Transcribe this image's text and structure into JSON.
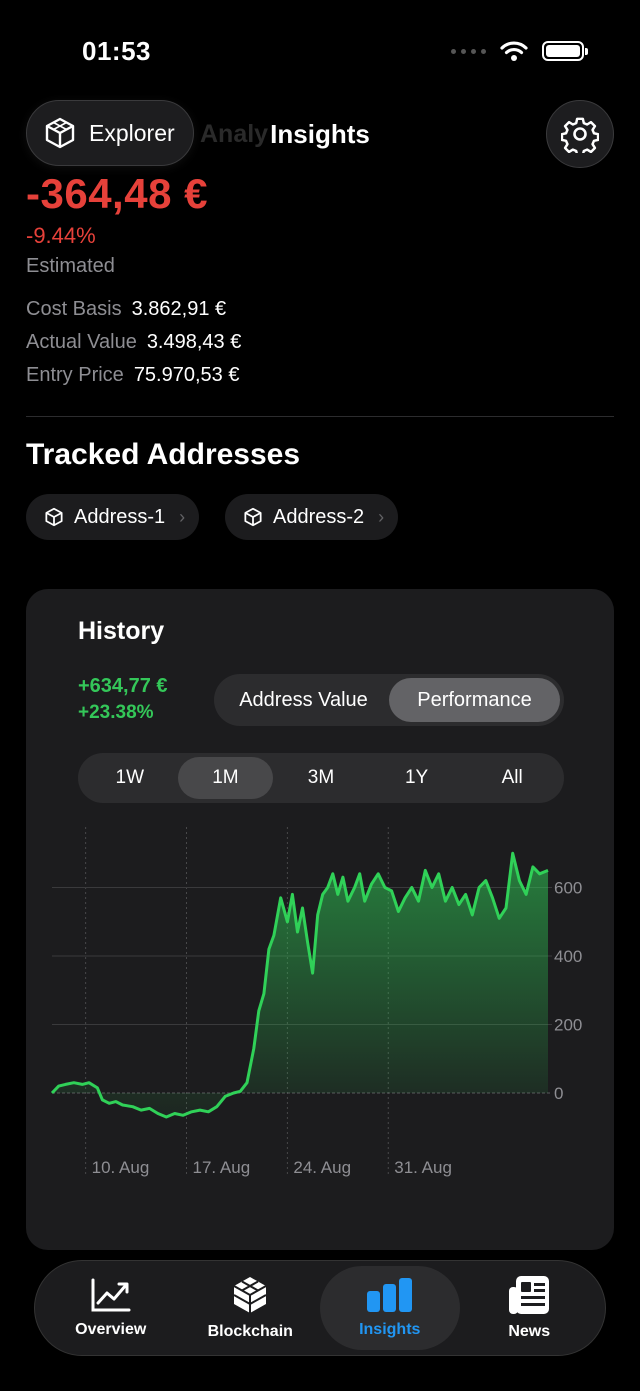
{
  "status": {
    "time": "01:53"
  },
  "nav": {
    "explorer_label": "Explorer",
    "title": "Insights",
    "ghost_title": "Analy"
  },
  "summary": {
    "pl_value": "-364,48 €",
    "pl_percent": "-9.44%",
    "estimated": "Estimated",
    "stats": [
      {
        "label": "Cost Basis",
        "value": "3.862,91 €"
      },
      {
        "label": "Actual Value",
        "value": "3.498,43 €"
      },
      {
        "label": "Entry Price",
        "value": "75.970,53 €"
      }
    ],
    "loss_color": "#e6413a"
  },
  "tracked": {
    "title": "Tracked Addresses",
    "addresses": [
      {
        "label": "Address-1"
      },
      {
        "label": "Address-2"
      }
    ]
  },
  "history": {
    "title": "History",
    "change_value": "+634,77 €",
    "change_percent": "+23.38%",
    "gain_color": "#34c759",
    "modes": [
      {
        "label": "Address Value",
        "active": false
      },
      {
        "label": "Performance",
        "active": true
      }
    ],
    "ranges": [
      {
        "label": "1W",
        "active": false
      },
      {
        "label": "1M",
        "active": true
      },
      {
        "label": "3M",
        "active": false
      },
      {
        "label": "1Y",
        "active": false
      },
      {
        "label": "All",
        "active": false
      }
    ]
  },
  "chart_data": {
    "type": "area",
    "x_tick_labels": [
      "10. Aug",
      "17. Aug",
      "24. Aug",
      "31. Aug"
    ],
    "y_ticks": [
      0,
      200,
      400,
      600
    ],
    "ylim": [
      -80,
      780
    ],
    "x_range": [
      0,
      29.5
    ],
    "series": [
      {
        "x": [
          0.0,
          0.4,
          0.8,
          1.3,
          1.8,
          2.2,
          2.7,
          3.0,
          3.4,
          3.8,
          4.2,
          4.8,
          5.3,
          5.8,
          6.3,
          6.8,
          7.3,
          7.8,
          8.3,
          8.8,
          9.3,
          9.8,
          10.3,
          10.8,
          11.2,
          11.6,
          12.0,
          12.3,
          12.6,
          12.9,
          13.2,
          13.6,
          14.0,
          14.3,
          14.6,
          14.9,
          15.2,
          15.5,
          15.8,
          16.1,
          16.4,
          16.7,
          17.0,
          17.3,
          17.6,
          18.0,
          18.3,
          18.6,
          19.0,
          19.4,
          19.8,
          20.2,
          20.6,
          21.0,
          21.4,
          21.8,
          22.2,
          22.6,
          23.0,
          23.4,
          23.8,
          24.2,
          24.6,
          25.0,
          25.4,
          25.8,
          26.2,
          26.6,
          27.0,
          27.4,
          27.8,
          28.2,
          28.6,
          29.0,
          29.5
        ],
        "y": [
          0,
          20,
          25,
          30,
          25,
          30,
          15,
          -20,
          -30,
          -25,
          -35,
          -40,
          -50,
          -45,
          -60,
          -70,
          -60,
          -65,
          -55,
          -50,
          -55,
          -40,
          -10,
          0,
          5,
          30,
          130,
          240,
          290,
          420,
          460,
          570,
          500,
          580,
          470,
          540,
          440,
          350,
          520,
          580,
          600,
          640,
          580,
          630,
          560,
          600,
          640,
          560,
          610,
          640,
          600,
          590,
          530,
          570,
          600,
          560,
          650,
          600,
          640,
          560,
          600,
          550,
          580,
          520,
          600,
          620,
          570,
          510,
          540,
          700,
          620,
          580,
          660,
          640,
          650
        ]
      }
    ]
  },
  "tabs": [
    {
      "label": "Overview",
      "icon": "chart-line-icon",
      "active": false
    },
    {
      "label": "Blockchain",
      "icon": "blockchain-cube-icon",
      "active": false
    },
    {
      "label": "Insights",
      "icon": "bar-chart-icon",
      "active": true
    },
    {
      "label": "News",
      "icon": "newspaper-icon",
      "active": false
    }
  ]
}
